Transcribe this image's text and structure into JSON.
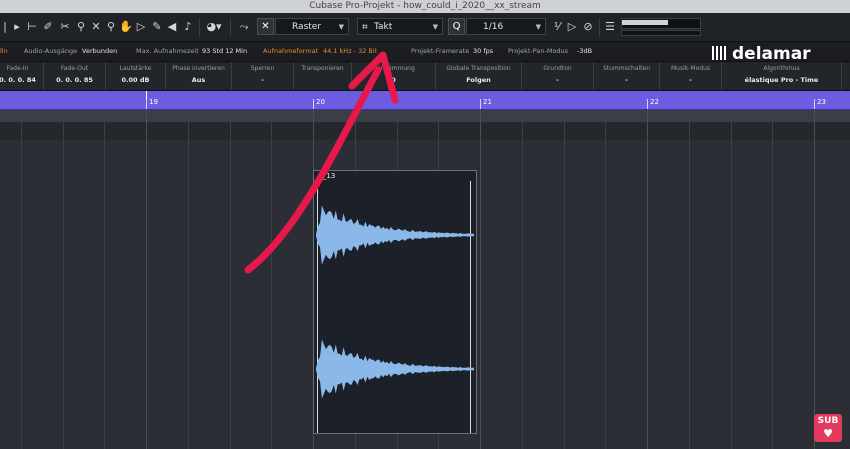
{
  "window": {
    "title": "Cubase Pro-Projekt - how_could_i_2020__xx_stream"
  },
  "toolbar": {
    "snap_type": "Raster",
    "grid_type": "Takt",
    "quantize": "1/16",
    "quantize_icon": "Q",
    "grid_icon": "⌗",
    "tools": [
      "select-tool",
      "range-tool",
      "erase-tool",
      "split-tool",
      "glue-tool",
      "zoom-tool",
      "mute-tool",
      "draw-tool",
      "play-tool",
      "speaker-tool",
      "snap-tool"
    ]
  },
  "status": {
    "audio_out_label": "Audio-Ausgänge",
    "audio_out_value": "Verbunden",
    "rec_time_label": "Max. Aufnahmezeit",
    "rec_time_value": "93 Std 12 Min",
    "rec_format_label": "Aufnahmeformat",
    "rec_format_value": "44.1 kHz - 32 Bit",
    "framerate_label": "Projekt-Framerate",
    "framerate_value": "30 fps",
    "pan_label": "Projekt-Pan-Modus",
    "pan_value": "-3dB"
  },
  "brand": {
    "name": "delamar"
  },
  "infoline": [
    {
      "label": "Fade-In",
      "value": "0. 0. 0. 84"
    },
    {
      "label": "Fade-Out",
      "value": "0. 0. 0. 85"
    },
    {
      "label": "Lautstärke",
      "value": "0.00   dB"
    },
    {
      "label": "Phase invertieren",
      "value": "Aus"
    },
    {
      "label": "Sperren",
      "value": "-"
    },
    {
      "label": "Transponieren",
      "value": ""
    },
    {
      "label": "Feinstimmung",
      "value": "0"
    },
    {
      "label": "Globale Transposition",
      "value": "Folgen"
    },
    {
      "label": "Grundton",
      "value": "-"
    },
    {
      "label": "Stummschalten",
      "value": "-"
    },
    {
      "label": "Musik-Modus",
      "value": "-"
    },
    {
      "label": "Algorithmus",
      "value": "élastique Pro - Time"
    }
  ],
  "ruler": {
    "bars": [
      "19",
      "20",
      "21",
      "22",
      "23"
    ]
  },
  "clip": {
    "name": "R_13"
  },
  "badge": {
    "text": "SUB"
  },
  "colors": {
    "ruler": "#6c5ce0",
    "waveform": "#8ab8e8",
    "arrow": "#e8194a",
    "badge": "#e33b5e",
    "accent_orange": "#e98a2c"
  }
}
